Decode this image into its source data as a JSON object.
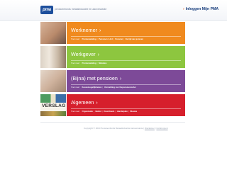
{
  "header": {
    "logo_text": "pma",
    "tagline": "pensioenfonds metaalindustrie en aanverwante",
    "login_label": "Inloggen Mijn PMA",
    "login_arrow": "›"
  },
  "rows": [
    {
      "title": "Werknemer",
      "chevron": "›",
      "lead": "Snel naar:",
      "links": [
        "Premiebetaling",
        "Pensioen 1-2-3",
        "Pension",
        "De tijd van je leven"
      ],
      "color": "#f08a1e"
    },
    {
      "title": "Werkgever",
      "chevron": "›",
      "lead": "Snel naar:",
      "links": [
        "Premiebetaling",
        "Mutaties"
      ],
      "color": "#8dc63f"
    },
    {
      "title": "(Bijna) met pensioen",
      "chevron": "›",
      "lead": "Snel naar:",
      "links": [
        "Keuzemogelijkheden",
        "Vermelding van Ouponsioenorder"
      ],
      "color": "#7d4a98"
    },
    {
      "title": "Algemeen",
      "chevron": "›",
      "lead": "Snel naar:",
      "links": [
        "Organisatie",
        "Beleid",
        "Downloads",
        "Handelplan",
        "Nieuws"
      ],
      "color": "#d61f2c"
    }
  ],
  "book_word": "VERSLAG",
  "link_separator": "|",
  "footer": {
    "copyright": "Copyright © 2010 Pensioenfonds Metaalindustrie Aanverwante",
    "links": [
      "Disclaimer",
      "Colofonpunt"
    ],
    "separator": "|"
  }
}
